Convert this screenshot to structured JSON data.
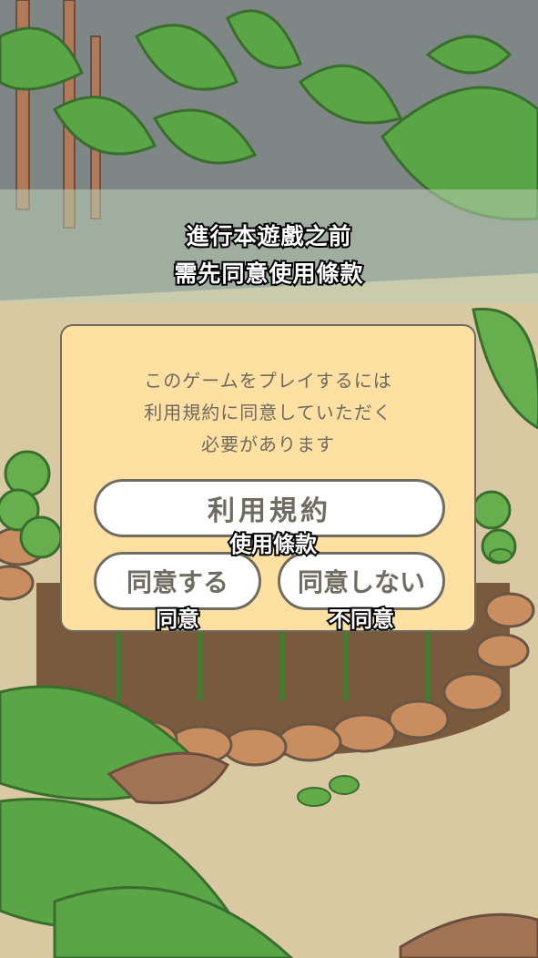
{
  "overlay": {
    "line1": "進行本遊戲之前",
    "line2": "需先同意使用條款"
  },
  "dialog": {
    "message_lines": [
      "このゲームをプレイするには",
      "利用規約に同意していただく",
      "必要があります"
    ],
    "terms_button": {
      "label": "利用規約",
      "subtitle": "使用條款"
    },
    "agree_button": {
      "label": "同意する",
      "subtitle": "同意"
    },
    "disagree_button": {
      "label": "同意しない",
      "subtitle": "不同意"
    }
  },
  "colors": {
    "dialog_bg": "#ffe0a3",
    "border": "#6f6c62",
    "leaf_green": "#4f9a3a",
    "soil": "#7a5a3c"
  }
}
